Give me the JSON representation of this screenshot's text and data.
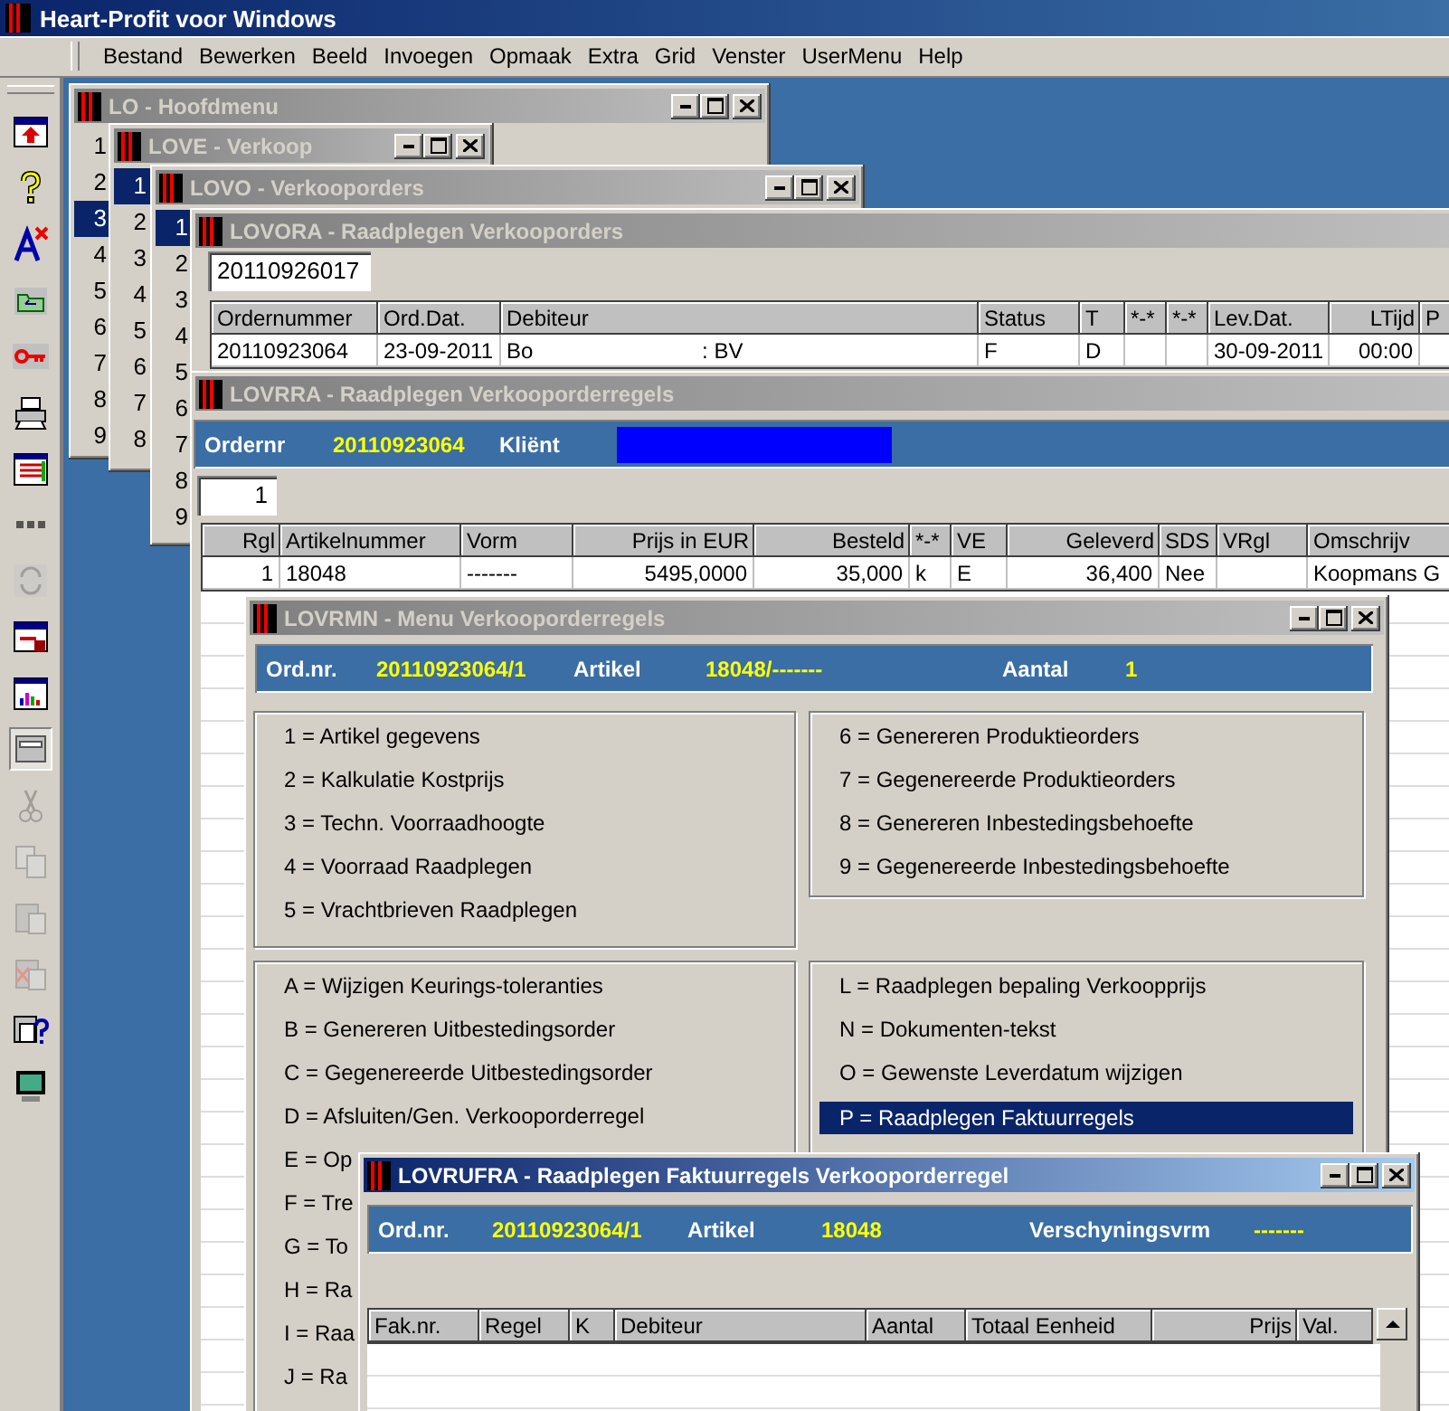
{
  "app_title": "Heart-Profit voor Windows",
  "menu": [
    "Bestand",
    "Bewerken",
    "Beeld",
    "Invoegen",
    "Opmaak",
    "Extra",
    "Grid",
    "Venster",
    "UserMenu",
    "Help"
  ],
  "toolbar": [
    {
      "kind": "window-arrow",
      "disabled": false,
      "pressed": false
    },
    {
      "kind": "question",
      "disabled": false,
      "pressed": false
    },
    {
      "kind": "triangle-cross",
      "disabled": false,
      "pressed": false
    },
    {
      "kind": "folder",
      "disabled": false,
      "pressed": false
    },
    {
      "kind": "key",
      "disabled": false,
      "pressed": false
    },
    {
      "kind": "printer",
      "disabled": false,
      "pressed": false
    },
    {
      "kind": "window-list",
      "disabled": false,
      "pressed": false
    },
    {
      "kind": "dots",
      "disabled": false,
      "pressed": false
    },
    {
      "kind": "refresh",
      "disabled": true,
      "pressed": false
    },
    {
      "kind": "lock-window",
      "disabled": false,
      "pressed": false
    },
    {
      "kind": "chart",
      "disabled": false,
      "pressed": false
    },
    {
      "kind": "window",
      "disabled": false,
      "pressed": true
    },
    {
      "kind": "scissors",
      "disabled": true,
      "pressed": false
    },
    {
      "kind": "copy",
      "disabled": true,
      "pressed": false
    },
    {
      "kind": "paste",
      "disabled": true,
      "pressed": false
    },
    {
      "kind": "paste-cross",
      "disabled": true,
      "pressed": false
    },
    {
      "kind": "paste-question",
      "disabled": false,
      "pressed": false
    },
    {
      "kind": "monitor",
      "disabled": false,
      "pressed": false
    }
  ],
  "windows": [
    {
      "kind": "number-list",
      "title": "LO - Hoofdmenu",
      "active": false,
      "items": [
        {
          "label": "1",
          "selected": false
        },
        {
          "label": "2",
          "selected": false
        },
        {
          "label": "3",
          "selected": true
        },
        {
          "label": "4",
          "selected": false
        },
        {
          "label": "5",
          "selected": false
        },
        {
          "label": "6",
          "selected": false
        },
        {
          "label": "7",
          "selected": false
        },
        {
          "label": "8",
          "selected": false
        },
        {
          "label": "9",
          "selected": false
        }
      ]
    },
    {
      "kind": "number-list",
      "title": "LOVE - Verkoop",
      "active": false,
      "items": [
        {
          "label": "1",
          "selected": true
        },
        {
          "label": "2",
          "selected": false
        },
        {
          "label": "3",
          "selected": false
        },
        {
          "label": "4",
          "selected": false
        },
        {
          "label": "5",
          "selected": false
        },
        {
          "label": "6",
          "selected": false
        },
        {
          "label": "7",
          "selected": false
        },
        {
          "label": "8",
          "selected": false
        }
      ]
    },
    {
      "kind": "number-list",
      "title": "LOVO - Verkooporders",
      "active": false,
      "items": [
        {
          "label": "1",
          "selected": true
        },
        {
          "label": "2",
          "selected": false
        },
        {
          "label": "3",
          "selected": false
        },
        {
          "label": "4",
          "selected": false
        },
        {
          "label": "5",
          "selected": false
        },
        {
          "label": "6",
          "selected": false
        },
        {
          "label": "7",
          "selected": false
        },
        {
          "label": "8",
          "selected": false
        },
        {
          "label": "9",
          "selected": false
        }
      ]
    },
    {
      "kind": "order-table",
      "title": "LOVORA - Raadplegen Verkooporders",
      "active": false,
      "field": "20110926017",
      "columns": [
        {
          "label": "Ordernummer"
        },
        {
          "label": "Ord.Dat."
        },
        {
          "label": "Debiteur"
        },
        {
          "label": "Status"
        },
        {
          "label": "T"
        },
        {
          "label": "*-*"
        },
        {
          "label": "*-*"
        },
        {
          "label": "Lev.Dat."
        },
        {
          "label": "LTijd"
        },
        {
          "label": "P"
        }
      ],
      "rows": [
        [
          "20110923064",
          "23-09-2011",
          "Bo                            : BV",
          "F",
          "D",
          null,
          null,
          "30-09-2011",
          "00:00",
          null
        ]
      ]
    },
    {
      "kind": "order-lines",
      "title": "LOVRRA - Raadplegen Verkooporderregels",
      "active": false,
      "header": [
        {
          "label": "Ordernr",
          "value": "20110923064"
        },
        {
          "label": "Kliënt",
          "redacted": true
        }
      ],
      "field": "1",
      "columns": [
        {
          "label": "Rgl"
        },
        {
          "label": "Artikelnummer"
        },
        {
          "label": "Vorm"
        },
        {
          "label": "Prijs in EUR"
        },
        {
          "label": "Besteld"
        },
        {
          "label": "*-*"
        },
        {
          "label": "VE"
        },
        {
          "label": "Geleverd"
        },
        {
          "label": "SDS"
        },
        {
          "label": "VRgl"
        },
        {
          "label": "Omschrijv"
        }
      ],
      "rows": [
        [
          "1",
          "18048",
          "-------",
          "5495,0000",
          "35,000",
          "k",
          "E",
          "36,400",
          "Nee",
          null,
          "Koopmans G"
        ]
      ]
    },
    {
      "kind": "line-menu",
      "title": "LOVRMN - Menu Verkooporderregels",
      "active": false,
      "header": [
        {
          "label": "Ord.nr.",
          "value": "20110923064/1"
        },
        {
          "label": "Artikel",
          "value": "18048/-------"
        },
        {
          "label": "Aantal",
          "value": "1"
        }
      ],
      "groups": [
        {
          "items": [
            {
              "label": "1 = Artikel gegevens",
              "selected": false
            },
            {
              "label": "2 = Kalkulatie Kostprijs",
              "selected": false
            },
            {
              "label": "3 = Techn. Voorraadhoogte",
              "selected": false
            },
            {
              "label": "4 = Voorraad Raadplegen",
              "selected": false
            },
            {
              "label": "5 = Vrachtbrieven Raadplegen",
              "selected": false
            }
          ]
        },
        {
          "items": [
            {
              "label": "6 = Genereren Produktieorders",
              "selected": false
            },
            {
              "label": "7 = Gegenereerde Produktieorders",
              "selected": false
            },
            {
              "label": "8 = Genereren Inbestedingsbehoefte",
              "selected": false
            },
            {
              "label": "9 = Gegenereerde Inbestedingsbehoefte",
              "selected": false
            }
          ]
        },
        {
          "items": [
            {
              "label": "A = Wijzigen Keurings-toleranties",
              "selected": false
            },
            {
              "label": "B = Genereren Uitbestedingsorder",
              "selected": false
            },
            {
              "label": "C = Gegenereerde Uitbestedingsorder",
              "selected": false
            },
            {
              "label": "D = Afsluiten/Gen. Verkooporderregel",
              "selected": false
            },
            {
              "label": "E = Op",
              "selected": false
            },
            {
              "label": "F = Tre",
              "selected": false
            },
            {
              "label": "G = To",
              "selected": false
            },
            {
              "label": "H = Ra",
              "selected": false
            },
            {
              "label": "I = Raa",
              "selected": false
            },
            {
              "label": "J = Ra",
              "selected": false
            }
          ]
        },
        {
          "items": [
            {
              "label": "L = Raadplegen bepaling Verkoopprijs",
              "selected": false
            },
            {
              "label": "N = Dokumenten-tekst",
              "selected": false
            },
            {
              "label": "O = Gewenste Leverdatum wijzigen",
              "selected": false
            },
            {
              "label": "P = Raadplegen Faktuurregels",
              "selected": true
            }
          ]
        }
      ]
    },
    {
      "kind": "invoice-lines",
      "title": "LOVRUFRA - Raadplegen Faktuurregels Verkooporderregel",
      "active": true,
      "header": [
        {
          "label": "Ord.nr.",
          "value": "20110923064/1"
        },
        {
          "label": "Artikel",
          "value": "18048"
        },
        {
          "label": "Verschyningsvrm",
          "value": "-------"
        }
      ],
      "columns": [
        {
          "label": "Fak.nr."
        },
        {
          "label": "Regel"
        },
        {
          "label": "K"
        },
        {
          "label": "Debiteur"
        },
        {
          "label": "Aantal"
        },
        {
          "label": "Totaal Eenheid"
        },
        {
          "label": "Prijs"
        },
        {
          "label": "Val."
        }
      ]
    }
  ]
}
